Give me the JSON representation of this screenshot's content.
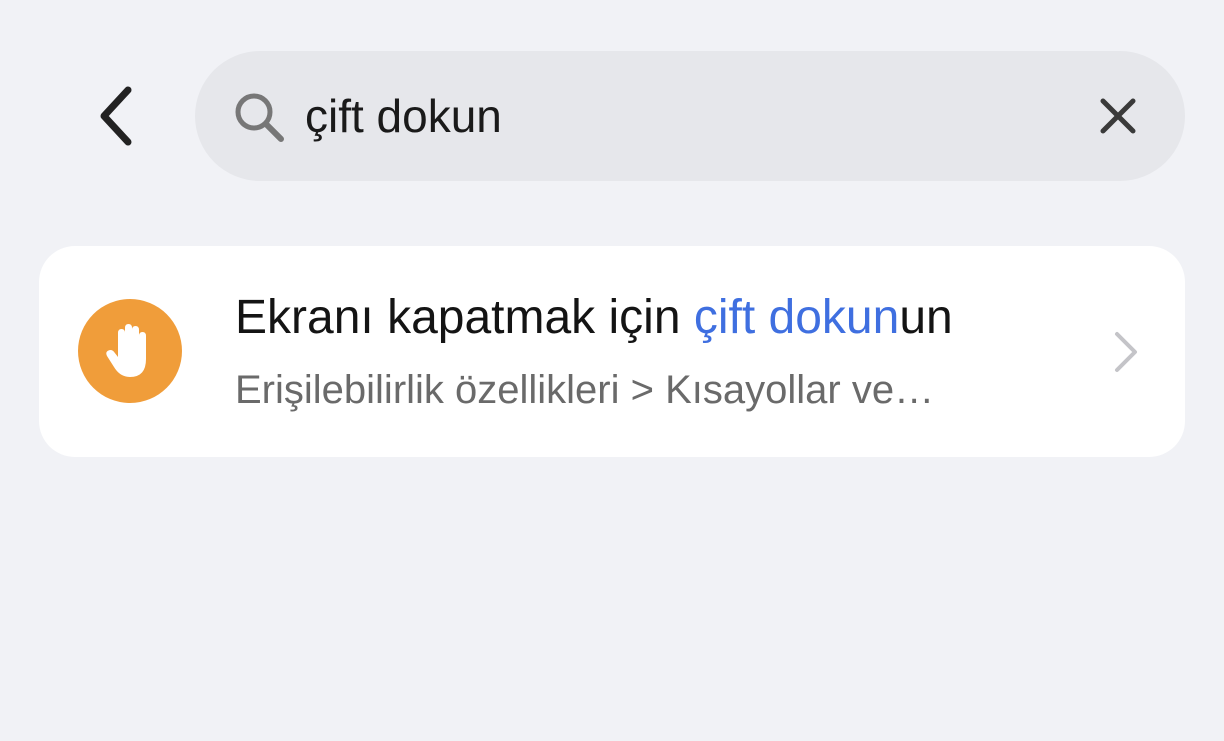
{
  "header": {
    "back_icon": "chevron-left-icon"
  },
  "search": {
    "icon": "search-icon",
    "value": "çift dokun",
    "clear_icon": "close-icon"
  },
  "results": [
    {
      "icon": "hand-stop-icon",
      "icon_color": "#f09d3a",
      "title_prefix": "Ekranı kapatmak için ",
      "title_highlight": "çift dokun",
      "title_suffix": "un",
      "subtitle": "Erişilebilirlik özellikleri > Kısayollar ve…",
      "chevron_icon": "chevron-right-icon"
    }
  ],
  "colors": {
    "background": "#f1f2f6",
    "search_bg": "#e6e7eb",
    "card_bg": "#ffffff",
    "highlight": "#3f6fe0",
    "subtitle": "#6a6a6a"
  }
}
